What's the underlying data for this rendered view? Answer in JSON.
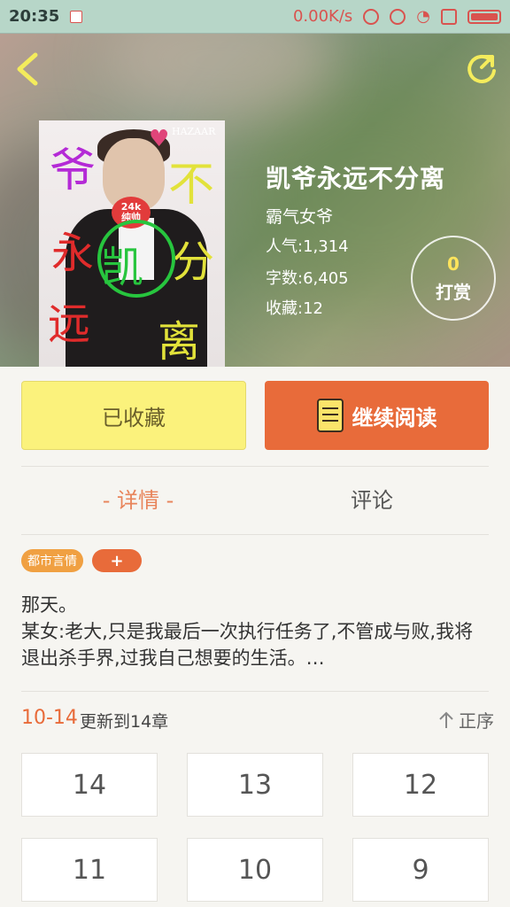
{
  "status_bar": {
    "time": "20:35",
    "network_speed": "0.00K/s"
  },
  "book": {
    "title": "凯爷永远不分离",
    "author": "霸气女爷",
    "popularity_label": "人气:1,314",
    "word_count_label": "字数:6,405",
    "favorites_label": "收藏:12"
  },
  "tip": {
    "count": "0",
    "label": "打赏"
  },
  "actions": {
    "collected_label": "已收藏",
    "continue_label": "继续阅读"
  },
  "tabs": {
    "detail_label": "- 详情 -",
    "comments_label": "评论"
  },
  "tags": {
    "genre": "都市言情",
    "add": "+"
  },
  "description": "那天。\n某女:老大,只是我最后一次执行任务了,不管成与败,我将退出杀手界,过我自己想要的生活。…",
  "update": {
    "date": "10-14",
    "text": "更新到14章",
    "sort_label": "正序"
  },
  "chapters": [
    "14",
    "13",
    "12",
    "11",
    "10",
    "9"
  ],
  "cover": {
    "badge": "24k\n纯帅",
    "brand": "HAZAAR"
  },
  "colors": {
    "accent": "#e86b3a",
    "collected_bg": "#fbf27c",
    "tag_genre": "#f0a042"
  }
}
